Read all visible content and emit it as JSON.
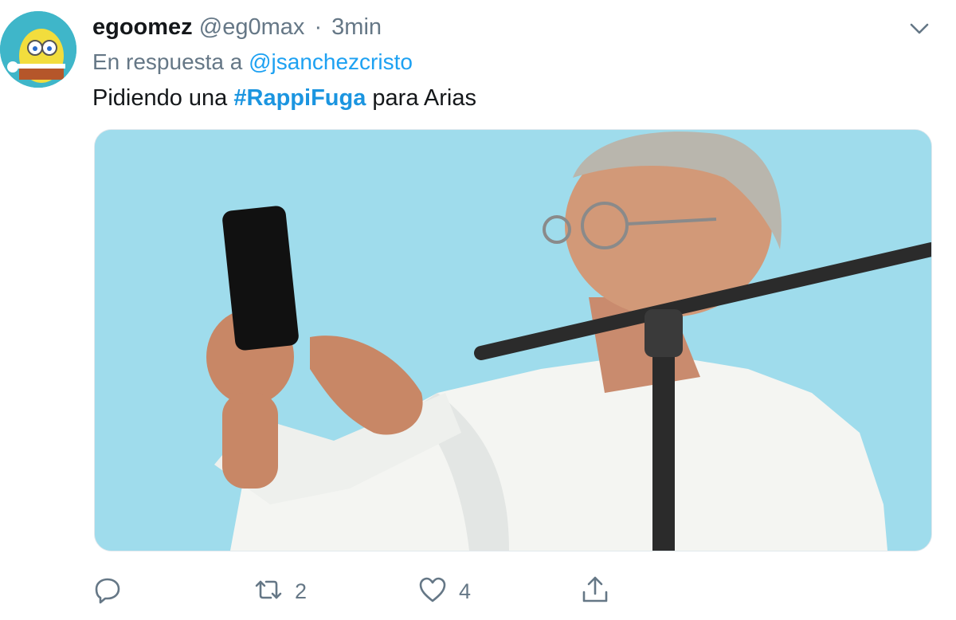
{
  "tweet": {
    "display_name": "egoomez",
    "handle": "@eg0max",
    "separator": "·",
    "time": "3min",
    "reply_prefix": "En respuesta a",
    "reply_to": "@jsanchezcristo",
    "text_before": "Pidiendo una",
    "hashtag": "#RappiFuga",
    "text_after": "para Arias"
  },
  "actions": {
    "reply_icon": "reply-icon",
    "retweet_icon": "retweet-icon",
    "retweet_count": "2",
    "like_icon": "heart-icon",
    "like_count": "4",
    "share_icon": "share-icon"
  },
  "colors": {
    "link": "#1da1f2",
    "hashtag": "#1b95e0",
    "muted": "#657786",
    "photo_background": "#9fdcec"
  }
}
